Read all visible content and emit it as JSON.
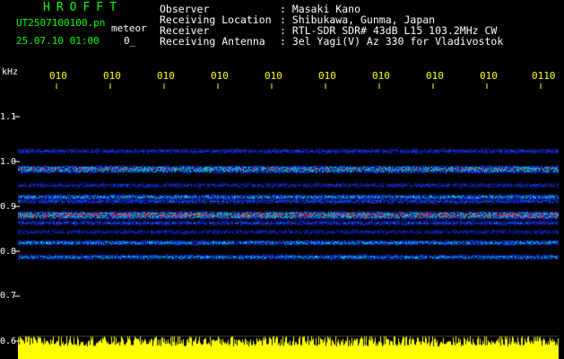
{
  "header": {
    "title": "HROFFT",
    "filename": "UT2507100100.pn",
    "meteor_label": "meteor",
    "datetime": "25.07.10 01:00",
    "count": "0_"
  },
  "info": {
    "observer_label": "Observer",
    "observer_value": ": Masaki Kano",
    "location_label": "Receiving Location",
    "location_value": ": Shibukawa, Gunma, Japan",
    "receiver_label": "Receiver",
    "receiver_value": ": RTL-SDR SDR# 43dB L15 103.2MHz CW",
    "antenna_label": "Receiving Antenna",
    "antenna_value": ": 3el Yagi(V) Az 330 for Vladivostok"
  },
  "axis": {
    "unit": "kHz",
    "y_ticks": [
      "1.1",
      "1.0",
      "0.9",
      "0.8",
      "0.7",
      "0.6"
    ],
    "x_ticks": [
      "010",
      "010",
      "010",
      "010",
      "010",
      "010",
      "010",
      "010",
      "010",
      "0110"
    ]
  },
  "colors": {
    "background": "#000000",
    "title": "#00ff00",
    "text": "#ffffff",
    "ticks": "#ffff00",
    "noise_floor": "#ffff00",
    "band_low": "#1030c0",
    "band_mid": "#00d0ff",
    "band_high": "#ff2040"
  }
}
